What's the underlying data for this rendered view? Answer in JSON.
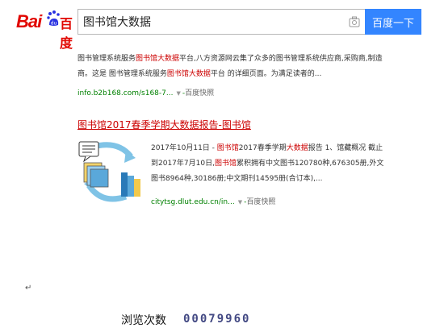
{
  "header": {
    "logo_text": "百度",
    "search_query": "图书馆大数据",
    "search_button": "百度一下"
  },
  "results": [
    {
      "snippet": [
        {
          "t": "图书管理系统服务"
        },
        {
          "t": "图书馆大数据",
          "hl": true
        },
        {
          "t": "平台,八方资源网云集了众多的图书管理系统供应商,采购商,制造商。这是 图书管理系统服务"
        },
        {
          "t": "图书馆大数据",
          "hl": true
        },
        {
          "t": "平台 的详细页面。为满足读者的..."
        }
      ],
      "url": "info.b2b168.com/s168-7...",
      "cache": "百度快照"
    },
    {
      "title": "图书馆2017春季学期大数据报告-图书馆",
      "snippet": [
        {
          "t": "2017年10月11日 - "
        },
        {
          "t": "图书馆",
          "hl": true
        },
        {
          "t": "2017春季学期"
        },
        {
          "t": "大数据",
          "hl": true
        },
        {
          "t": "报告 1、馆藏概况 截止到2017年7月10日,"
        },
        {
          "t": "图书馆",
          "hl": true
        },
        {
          "t": "累积拥有中文图书120780种,676305册,外文图书8964种,30186册;中文期刊14595册(合订本),..."
        }
      ],
      "url": "citytsg.dlut.edu.cn/in...",
      "cache": "百度快照"
    }
  ],
  "footer": {
    "paragraph_mark": "↵",
    "counter_label": "浏览次数",
    "counter_value": "00079960"
  },
  "colors": {
    "brand_red": "#e10601",
    "button_blue": "#3385ff",
    "url_green": "#008000",
    "counter_blue": "#444a84"
  }
}
